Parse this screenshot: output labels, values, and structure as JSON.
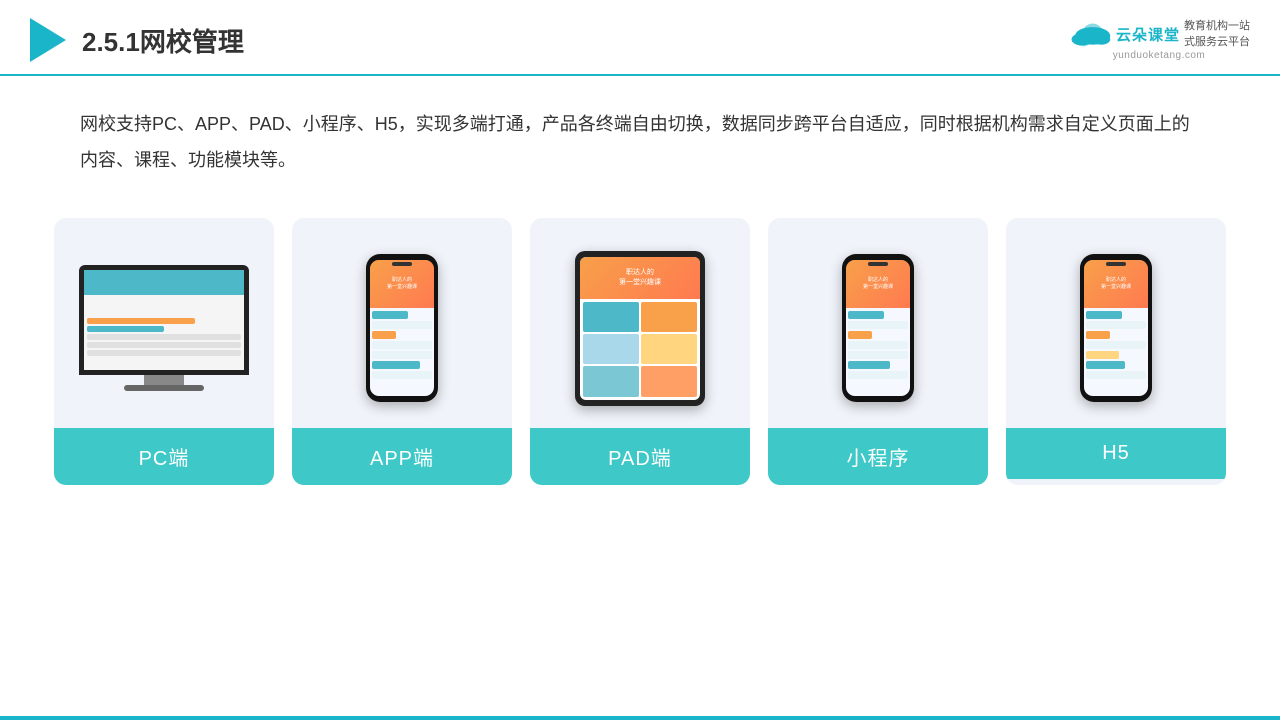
{
  "header": {
    "title": "2.5.1网校管理",
    "brand_name": "云朵课堂",
    "brand_url": "yunduoketang.com",
    "brand_slogan": "教育机构一站\n式服务云平台"
  },
  "description": {
    "text": "网校支持PC、APP、PAD、小程序、H5，实现多端打通，产品各终端自由切换，数据同步跨平台自适应，同时根据机构需求自定义页面上的内容、课程、功能模块等。"
  },
  "cards": [
    {
      "id": "pc",
      "label": "PC端"
    },
    {
      "id": "app",
      "label": "APP端"
    },
    {
      "id": "pad",
      "label": "PAD端"
    },
    {
      "id": "miniapp",
      "label": "小程序"
    },
    {
      "id": "h5",
      "label": "H5"
    }
  ]
}
